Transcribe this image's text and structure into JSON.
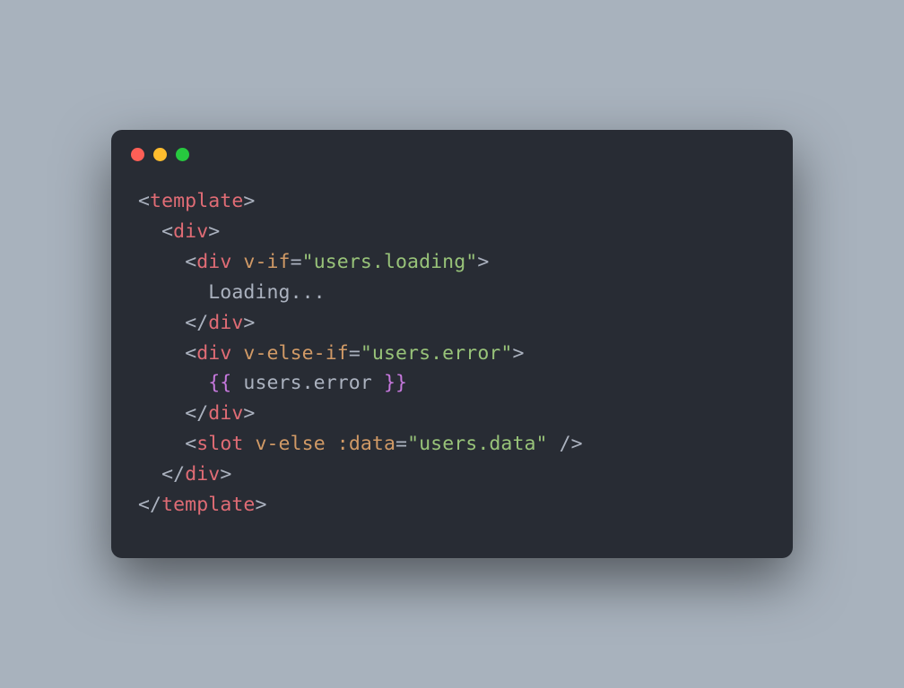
{
  "window": {
    "traffic_lights": {
      "close": "#ff5f56",
      "minimize": "#ffbd2e",
      "maximize": "#27c93f"
    }
  },
  "code": {
    "language": "vue-template",
    "lines": [
      {
        "indent": 0,
        "tokens": [
          {
            "t": "punct",
            "v": "<"
          },
          {
            "t": "tag",
            "v": "template"
          },
          {
            "t": "punct",
            "v": ">"
          }
        ]
      },
      {
        "indent": 1,
        "tokens": [
          {
            "t": "punct",
            "v": "<"
          },
          {
            "t": "tag",
            "v": "div"
          },
          {
            "t": "punct",
            "v": ">"
          }
        ]
      },
      {
        "indent": 2,
        "tokens": [
          {
            "t": "punct",
            "v": "<"
          },
          {
            "t": "tag",
            "v": "div"
          },
          {
            "t": "space",
            "v": " "
          },
          {
            "t": "attr",
            "v": "v-if"
          },
          {
            "t": "punct",
            "v": "="
          },
          {
            "t": "string",
            "v": "\"users.loading\""
          },
          {
            "t": "punct",
            "v": ">"
          }
        ]
      },
      {
        "indent": 3,
        "tokens": [
          {
            "t": "text",
            "v": "Loading..."
          }
        ]
      },
      {
        "indent": 2,
        "tokens": [
          {
            "t": "punct",
            "v": "</"
          },
          {
            "t": "tag",
            "v": "div"
          },
          {
            "t": "punct",
            "v": ">"
          }
        ]
      },
      {
        "indent": 2,
        "tokens": [
          {
            "t": "punct",
            "v": "<"
          },
          {
            "t": "tag",
            "v": "div"
          },
          {
            "t": "space",
            "v": " "
          },
          {
            "t": "attr",
            "v": "v-else-if"
          },
          {
            "t": "punct",
            "v": "="
          },
          {
            "t": "string",
            "v": "\"users.error\""
          },
          {
            "t": "punct",
            "v": ">"
          }
        ]
      },
      {
        "indent": 3,
        "tokens": [
          {
            "t": "brace",
            "v": "{{"
          },
          {
            "t": "text",
            "v": " users.error "
          },
          {
            "t": "brace",
            "v": "}}"
          }
        ]
      },
      {
        "indent": 2,
        "tokens": [
          {
            "t": "punct",
            "v": "</"
          },
          {
            "t": "tag",
            "v": "div"
          },
          {
            "t": "punct",
            "v": ">"
          }
        ]
      },
      {
        "indent": 2,
        "tokens": [
          {
            "t": "punct",
            "v": "<"
          },
          {
            "t": "tag",
            "v": "slot"
          },
          {
            "t": "space",
            "v": " "
          },
          {
            "t": "attr",
            "v": "v-else"
          },
          {
            "t": "space",
            "v": " "
          },
          {
            "t": "attr",
            "v": ":data"
          },
          {
            "t": "punct",
            "v": "="
          },
          {
            "t": "string",
            "v": "\"users.data\""
          },
          {
            "t": "space",
            "v": " "
          },
          {
            "t": "punct",
            "v": "/>"
          }
        ]
      },
      {
        "indent": 1,
        "tokens": [
          {
            "t": "punct",
            "v": "</"
          },
          {
            "t": "tag",
            "v": "div"
          },
          {
            "t": "punct",
            "v": ">"
          }
        ]
      },
      {
        "indent": 0,
        "tokens": [
          {
            "t": "punct",
            "v": "</"
          },
          {
            "t": "tag",
            "v": "template"
          },
          {
            "t": "punct",
            "v": ">"
          }
        ]
      }
    ]
  }
}
